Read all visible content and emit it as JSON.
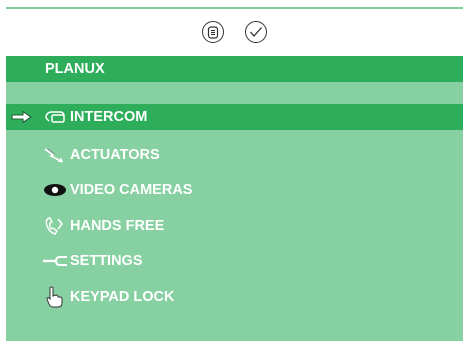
{
  "title": "PLANUX",
  "menu": {
    "items": [
      {
        "label": "INTERCOM",
        "icon": "intercom-handset-icon",
        "selected": true
      },
      {
        "label": "ACTUATORS",
        "icon": "lightning-bolt-icon",
        "selected": false
      },
      {
        "label": "VIDEO CAMERAS",
        "icon": "eye-icon",
        "selected": false
      },
      {
        "label": "HANDS FREE",
        "icon": "hands-free-phone-icon",
        "selected": false
      },
      {
        "label": "SETTINGS",
        "icon": "wrench-icon",
        "selected": false
      },
      {
        "label": "KEYPAD LOCK",
        "icon": "pointing-hand-icon",
        "selected": false
      }
    ]
  },
  "toolbar": {
    "list_icon": "list-icon",
    "confirm_icon": "checkmark-icon"
  },
  "colors": {
    "panel": "#87d0a1",
    "accent": "#2eae5b",
    "rule": "#82cc98",
    "text": "#ffffff"
  }
}
